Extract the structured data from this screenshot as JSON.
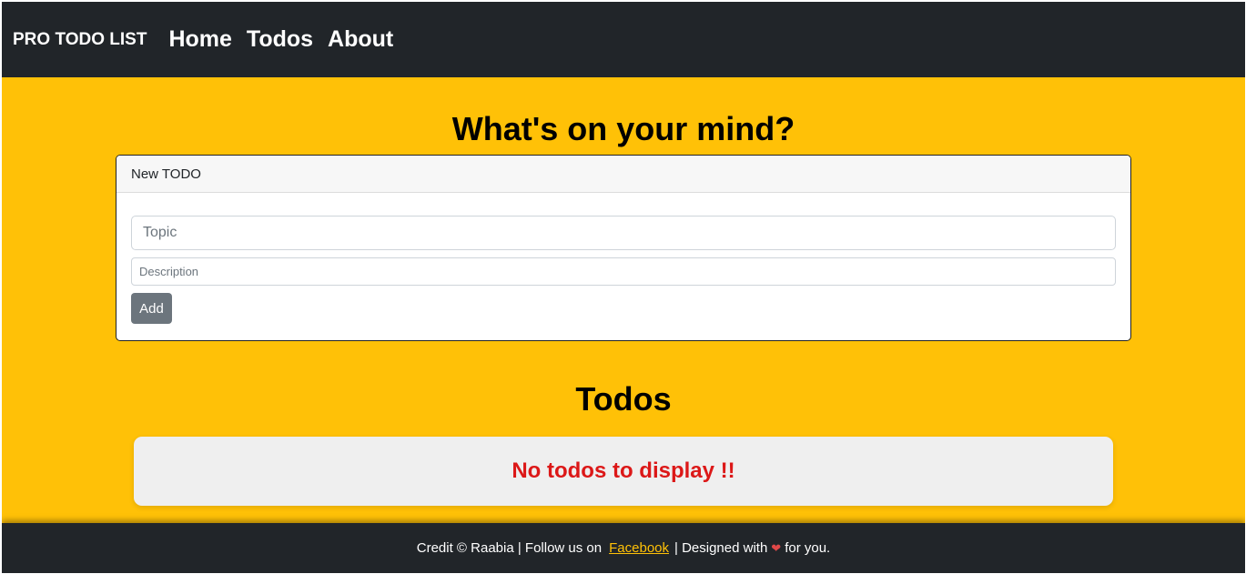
{
  "navbar": {
    "brand": "PRO TODO LIST",
    "links": [
      "Home",
      "Todos",
      "About"
    ]
  },
  "main": {
    "heading": "What's on your mind?",
    "card": {
      "header": "New TODO",
      "topic_placeholder": "Topic",
      "description_placeholder": "Description",
      "add_label": "Add"
    }
  },
  "todos": {
    "heading": "Todos",
    "empty_message": "No todos to display !!"
  },
  "footer": {
    "credit": "Credit © Raabia | Follow us on",
    "link": "Facebook",
    "designed": "| Designed with",
    "heart_icon": "heart-icon",
    "suffix": "for you."
  },
  "colors": {
    "navbar_bg": "#212529",
    "page_bg": "#ffc107",
    "empty_text": "#dc1818",
    "button_bg": "#6c757d"
  }
}
